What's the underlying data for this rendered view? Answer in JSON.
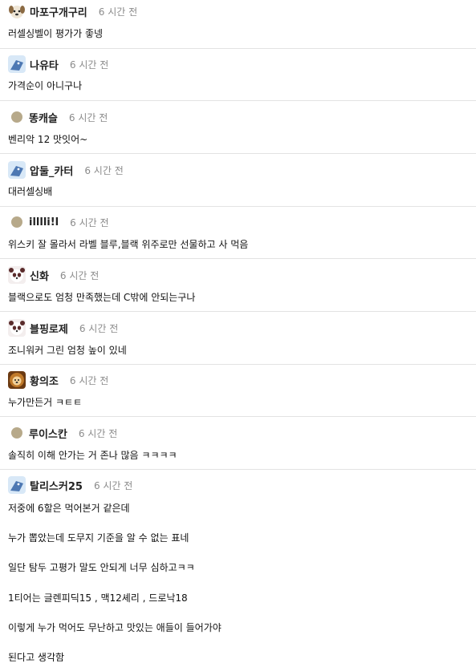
{
  "comments": [
    {
      "nick": "마포구개구리",
      "time": "6 시간 전",
      "avatar": "puppy-avatar-icon",
      "lines": [
        "러셀싱벨이 평가가 좋넹"
      ]
    },
    {
      "nick": "나유타",
      "time": "6 시간 전",
      "avatar": "bird-avatar-icon",
      "lines": [
        "가격순이 아니구나"
      ]
    },
    {
      "nick": "똥캐슬",
      "time": "6 시간 전",
      "avatar": "dot-avatar-icon",
      "lines": [
        "벤리악 12 맛잇어~"
      ]
    },
    {
      "nick": "압둘_카터",
      "time": "6 시간 전",
      "avatar": "bird-avatar-icon",
      "lines": [
        "대러셀싱배"
      ]
    },
    {
      "nick": "illlli!l",
      "time": "6 시간 전",
      "avatar": "dot-avatar-icon",
      "lines": [
        "위스키 잘 몰라서 라벨 블루,블랙 위주로만 선물하고 사 먹음"
      ]
    },
    {
      "nick": "신화",
      "time": "6 시간 전",
      "avatar": "panda-avatar-icon",
      "lines": [
        "블랙으로도 엄청 만족했는데 C밖에 안되는구나"
      ]
    },
    {
      "nick": "블핑로제",
      "time": "6 시간 전",
      "avatar": "panda-avatar-icon",
      "lines": [
        "조니워커 그린 엄청 높이 있네"
      ]
    },
    {
      "nick": "황의조",
      "time": "6 시간 전",
      "avatar": "lion-avatar-icon",
      "lines": [
        "누가만든거 ㅋㅌㅌ"
      ]
    },
    {
      "nick": "루이스칸",
      "time": "6 시간 전",
      "avatar": "dot-avatar-icon",
      "lines": [
        "솔직히 이해 안가는 거 존나 많음 ㅋㅋㅋㅋ"
      ]
    },
    {
      "nick": "탈리스커25",
      "time": "6 시간 전",
      "avatar": "bird-avatar-icon",
      "lines": [
        "저중에 6할은 먹어본거 같은데",
        "누가 뽑았는데 도무지 기준을 알 수 없는 표네",
        "일단 탐두 고평가 말도 안되게 너무 심하고ㅋㅋ",
        "1티어는 글렌피딕15 , 맥12셰리 , 드로낙18",
        "이렇게 누가 먹어도 무난하고 맛있는 애들이 들어가야",
        "된다고 생각함"
      ]
    }
  ]
}
